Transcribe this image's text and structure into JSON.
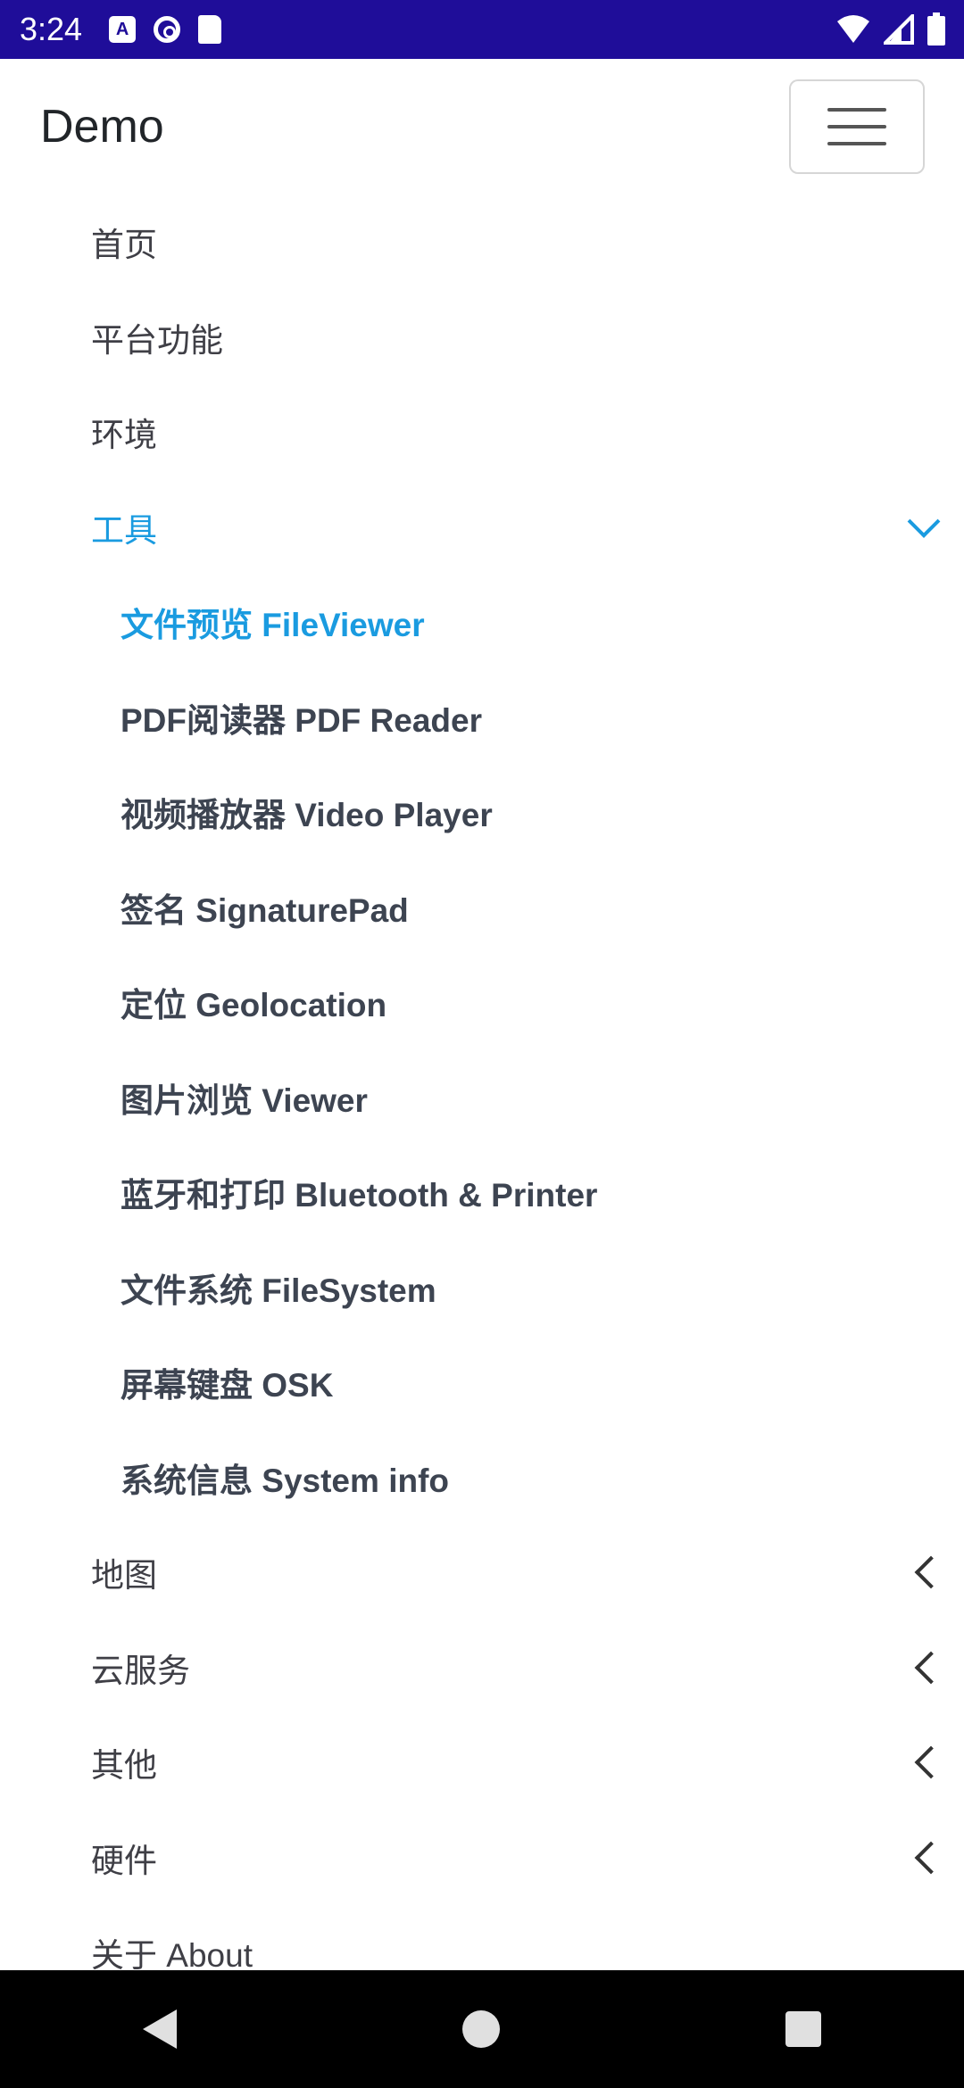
{
  "status_bar": {
    "time": "3:24",
    "left_icons": [
      "a-icon",
      "sync-icon",
      "sd-card-icon"
    ],
    "right_icons": [
      "wifi-icon",
      "signal-icon",
      "battery-icon"
    ]
  },
  "header": {
    "brand": "Demo"
  },
  "menu": {
    "items": [
      {
        "label": "首页"
      },
      {
        "label": "平台功能"
      },
      {
        "label": "环境"
      },
      {
        "label": "工具",
        "expanded": true,
        "children": [
          {
            "label": "文件预览 FileViewer",
            "active": true
          },
          {
            "label": "PDF阅读器 PDF Reader"
          },
          {
            "label": "视频播放器 Video Player"
          },
          {
            "label": "签名 SignaturePad"
          },
          {
            "label": "定位 Geolocation"
          },
          {
            "label": "图片浏览 Viewer"
          },
          {
            "label": "蓝牙和打印 Bluetooth & Printer"
          },
          {
            "label": "文件系统 FileSystem"
          },
          {
            "label": "屏幕键盘 OSK"
          },
          {
            "label": "系统信息 System info"
          }
        ]
      },
      {
        "label": "地图"
      },
      {
        "label": "云服务"
      },
      {
        "label": "其他"
      },
      {
        "label": "硬件"
      },
      {
        "label": "关于 About"
      }
    ]
  },
  "colors": {
    "status_bar": "#1f0d99",
    "accent": "#1a9be0",
    "nav_bar": "#000000"
  }
}
